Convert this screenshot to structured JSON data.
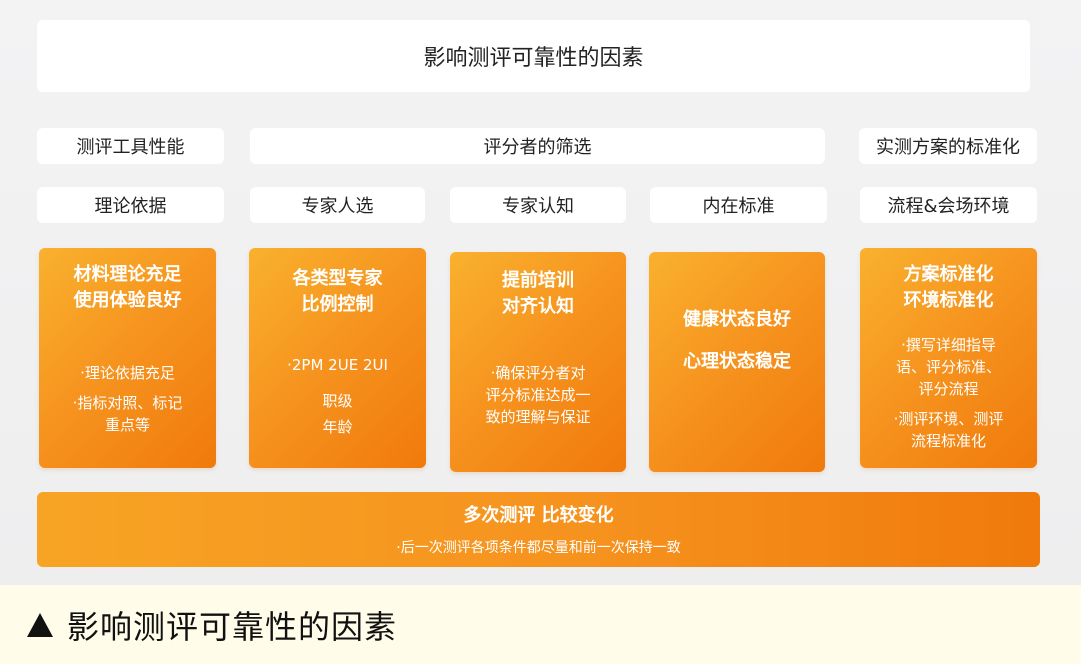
{
  "title": "影响测评可靠性的因素",
  "categories": {
    "tool": "测评工具性能",
    "screening": "评分者的筛选",
    "standard": "实测方案的标准化"
  },
  "subs": {
    "theory": "理论依据",
    "selection": "专家人选",
    "cognition": "专家认知",
    "inner": "内在标准",
    "process": "流程&会场环境"
  },
  "cards": {
    "theory": {
      "heads": [
        "材料理论充足",
        "使用体验良好"
      ],
      "items": [
        "·理论依据充足",
        "·指标对照、标记",
        "重点等"
      ]
    },
    "selection": {
      "heads": [
        "各类型专家",
        "比例控制"
      ],
      "items": [
        "·2PM 2UE 2UI",
        "职级",
        "年龄"
      ]
    },
    "cognition": {
      "heads": [
        "提前培训",
        "对齐认知"
      ],
      "items": [
        "·确保评分者对",
        "评分标准达成一",
        "致的理解与保证"
      ]
    },
    "inner": {
      "heads": [
        "健康状态良好",
        "心理状态稳定"
      ]
    },
    "process": {
      "heads": [
        "方案标准化",
        "环境标准化"
      ],
      "items": [
        "·撰写详细指导",
        "语、评分标准、",
        "评分流程",
        "·测评环境、测评",
        "流程标准化"
      ]
    }
  },
  "bottom": {
    "head": "多次测评 比较变化",
    "note": "·后一次测评各项条件都尽量和前一次保持一致"
  },
  "caption": "影响测评可靠性的因素"
}
